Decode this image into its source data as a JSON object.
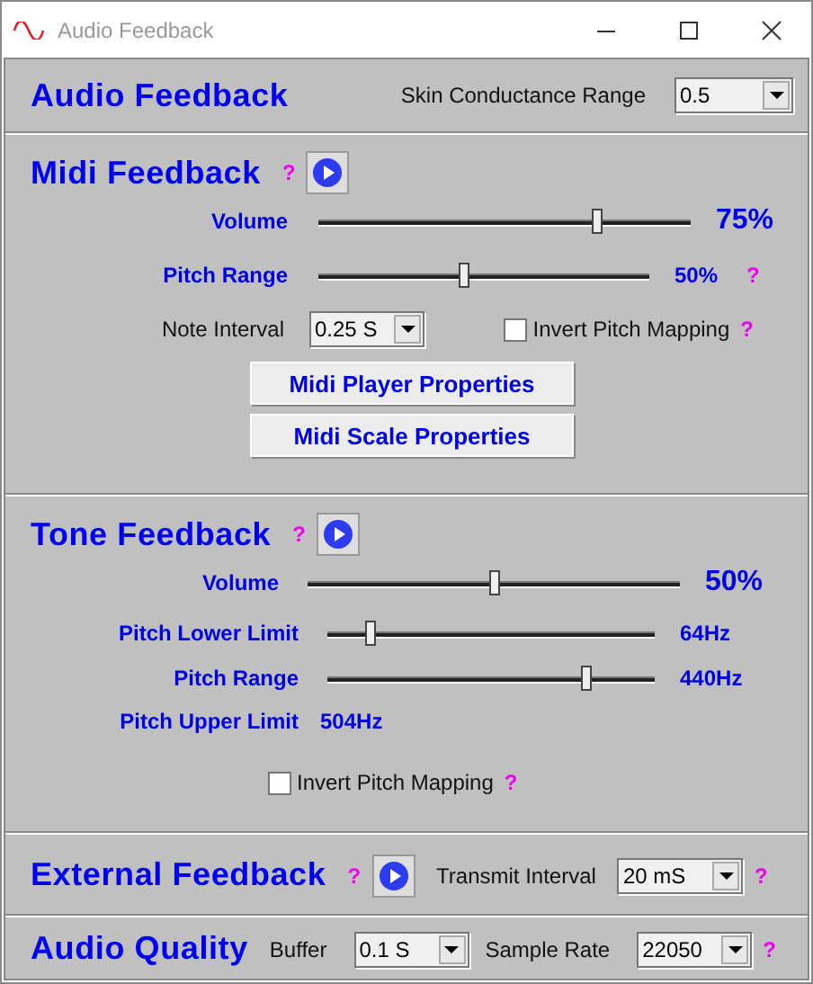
{
  "window": {
    "title": "Audio Feedback"
  },
  "audio_feedback": {
    "heading": "Audio Feedback",
    "range": {
      "label": "Skin Conductance Range",
      "value": "0.5"
    }
  },
  "midi": {
    "heading": "Midi Feedback",
    "help": "?",
    "sliders": [
      {
        "kind": "volume",
        "label": "Volume",
        "level": 0.75,
        "reading": "75%"
      },
      {
        "kind": "pitch",
        "label": "Pitch Range",
        "level": 0.44,
        "reading": "50%",
        "help": "?"
      }
    ],
    "note_interval": {
      "label": "Note Interval",
      "value": "0.25 S"
    },
    "invert": {
      "label": "Invert Pitch Mapping",
      "checked": false,
      "help": "?"
    },
    "buttons": [
      "Midi Player Properties",
      "Midi Scale Properties"
    ]
  },
  "tone": {
    "heading": "Tone Feedback",
    "help": "?",
    "sliders": [
      {
        "kind": "volume",
        "label": "Volume",
        "level": 0.5,
        "reading": "50%"
      },
      {
        "kind": "pitch",
        "label": "Pitch Lower Limit",
        "level": 0.13,
        "reading": "64Hz"
      },
      {
        "kind": "pitch",
        "label": "Pitch Range",
        "level": 0.79,
        "reading": "440Hz"
      }
    ],
    "upper_limit": {
      "label": "Pitch Upper Limit",
      "value": "504Hz"
    },
    "invert": {
      "label": "Invert Pitch Mapping",
      "checked": false,
      "help": "?"
    }
  },
  "external": {
    "heading": "External Feedback",
    "help": "?",
    "transmit": {
      "label": "Transmit Interval",
      "value": "20 mS",
      "help": "?"
    }
  },
  "quality": {
    "heading": "Audio Quality",
    "buffer": {
      "label": "Buffer",
      "value": "0.1 S"
    },
    "sample_rate": {
      "label": "Sample Rate",
      "value": "22050",
      "help": "?"
    }
  }
}
